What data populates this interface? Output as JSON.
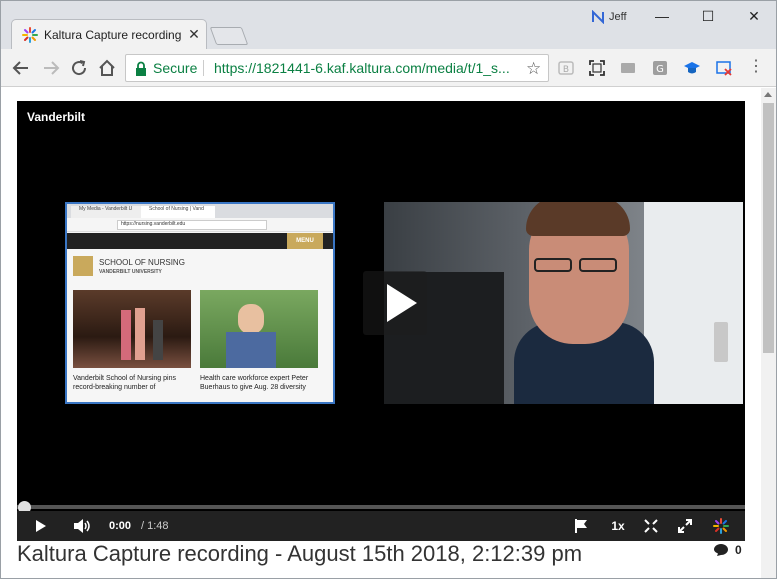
{
  "browser": {
    "tab_title": "Kaltura Capture recording",
    "profile_name": "Jeff",
    "omnibox": {
      "secure_label": "Secure",
      "url": "https://1821441-6.kaf.kaltura.com/media/t/1_s..."
    }
  },
  "player": {
    "brand": "Vanderbilt",
    "current_time": "0:00",
    "duration": "/ 1:48",
    "speed": "1x",
    "progress": 0
  },
  "screen_capture": {
    "tab1": "My Media - Vanderbilt U",
    "tab2": "School of Nursing | Vand",
    "address": "https://nursing.vanderbilt.edu",
    "menu": "MENU",
    "school_name": "SCHOOL OF NURSING",
    "university": "VANDERBILT UNIVERSITY",
    "news": [
      {
        "caption": "Vanderbilt School of Nursing pins record-breaking number of"
      },
      {
        "caption": "Health care workforce expert Peter Buerhaus to give Aug. 28 diversity"
      }
    ]
  },
  "page": {
    "title": "Kaltura Capture recording - August 15th 2018, 2:12:39 pm",
    "comment_count": "0"
  },
  "colors": {
    "secure_green": "#0b8043",
    "vanderbilt_gold": "#c9a95c",
    "tab_blue": "#3a76c4"
  }
}
